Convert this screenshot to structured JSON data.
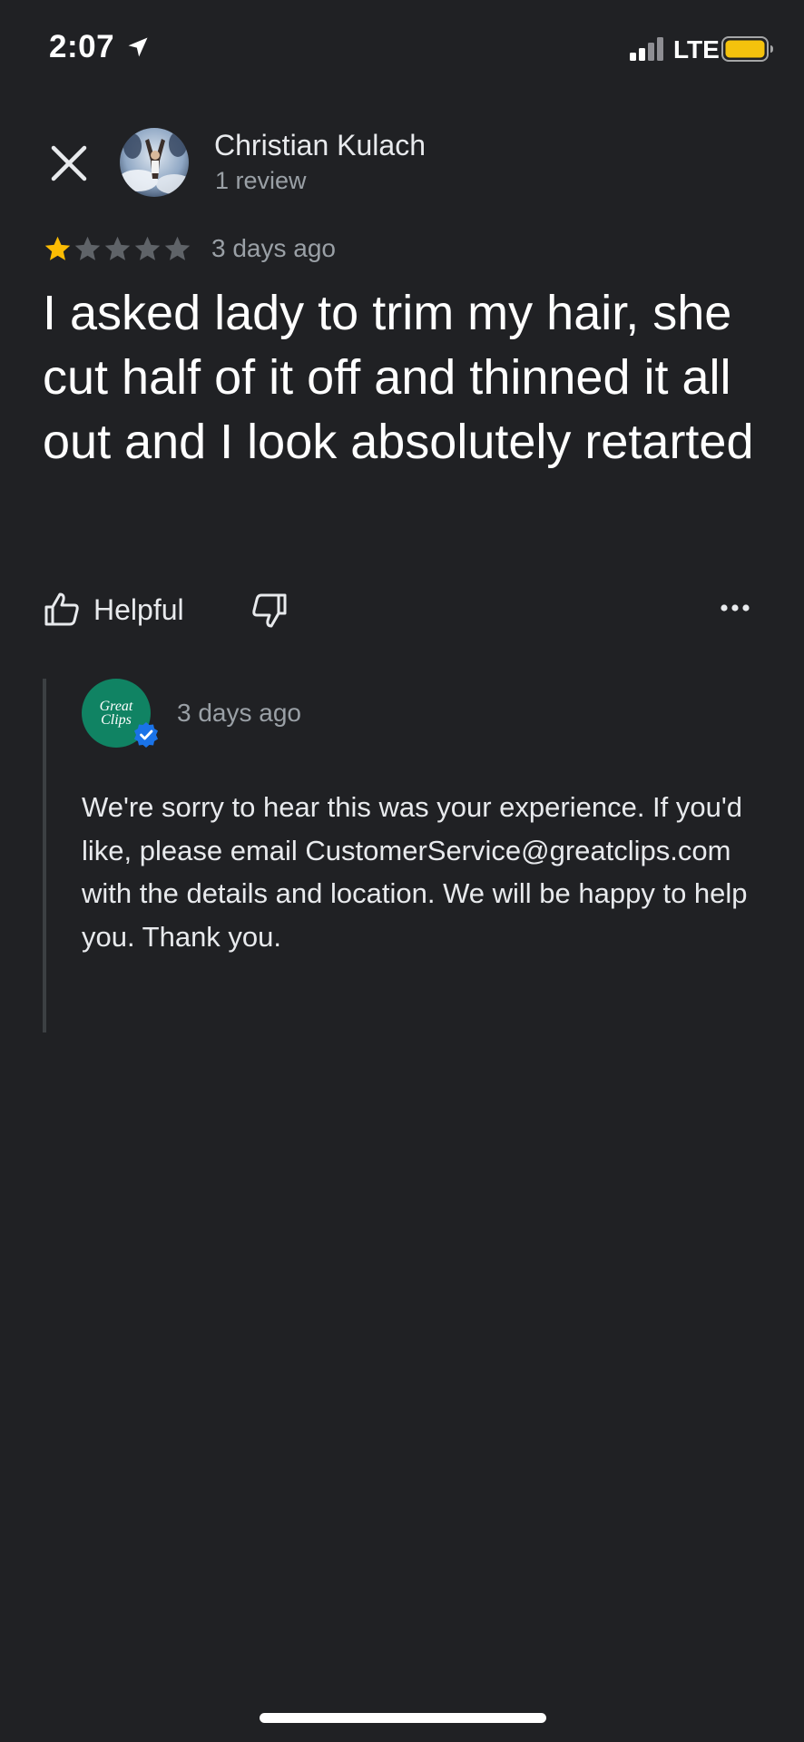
{
  "status_bar": {
    "time": "2:07",
    "network": "LTE",
    "battery_color": "#f4c20d",
    "icons": [
      "location-arrow-icon",
      "signal-icon",
      "battery-icon"
    ]
  },
  "reviewer": {
    "name": "Christian Kulach",
    "review_count": "1 review"
  },
  "review": {
    "rating": 1,
    "max_rating": 5,
    "date": "3 days ago",
    "text": "I asked lady to trim my hair, she cut half of it off and thinned it all out and I look absolutely retarted",
    "star_filled_color": "#fbbc04",
    "star_empty_color": "#5f6368"
  },
  "actions": {
    "helpful_label": "Helpful",
    "icons": [
      "thumbs-up-icon",
      "thumbs-down-icon",
      "more-options-icon"
    ]
  },
  "owner_reply": {
    "logo_line1": "Great",
    "logo_line2": "Clips",
    "logo_color": "#108363",
    "verified_color": "#1a73e8",
    "date": "3 days ago",
    "text": "We're sorry to hear this was your experience. If you'd like, please email CustomerService@greatclips.com with the details and location. We will be happy to help you. Thank you."
  },
  "theme": {
    "background": "#202124",
    "primary_text": "#ffffff",
    "secondary_text": "#9aa0a6"
  }
}
